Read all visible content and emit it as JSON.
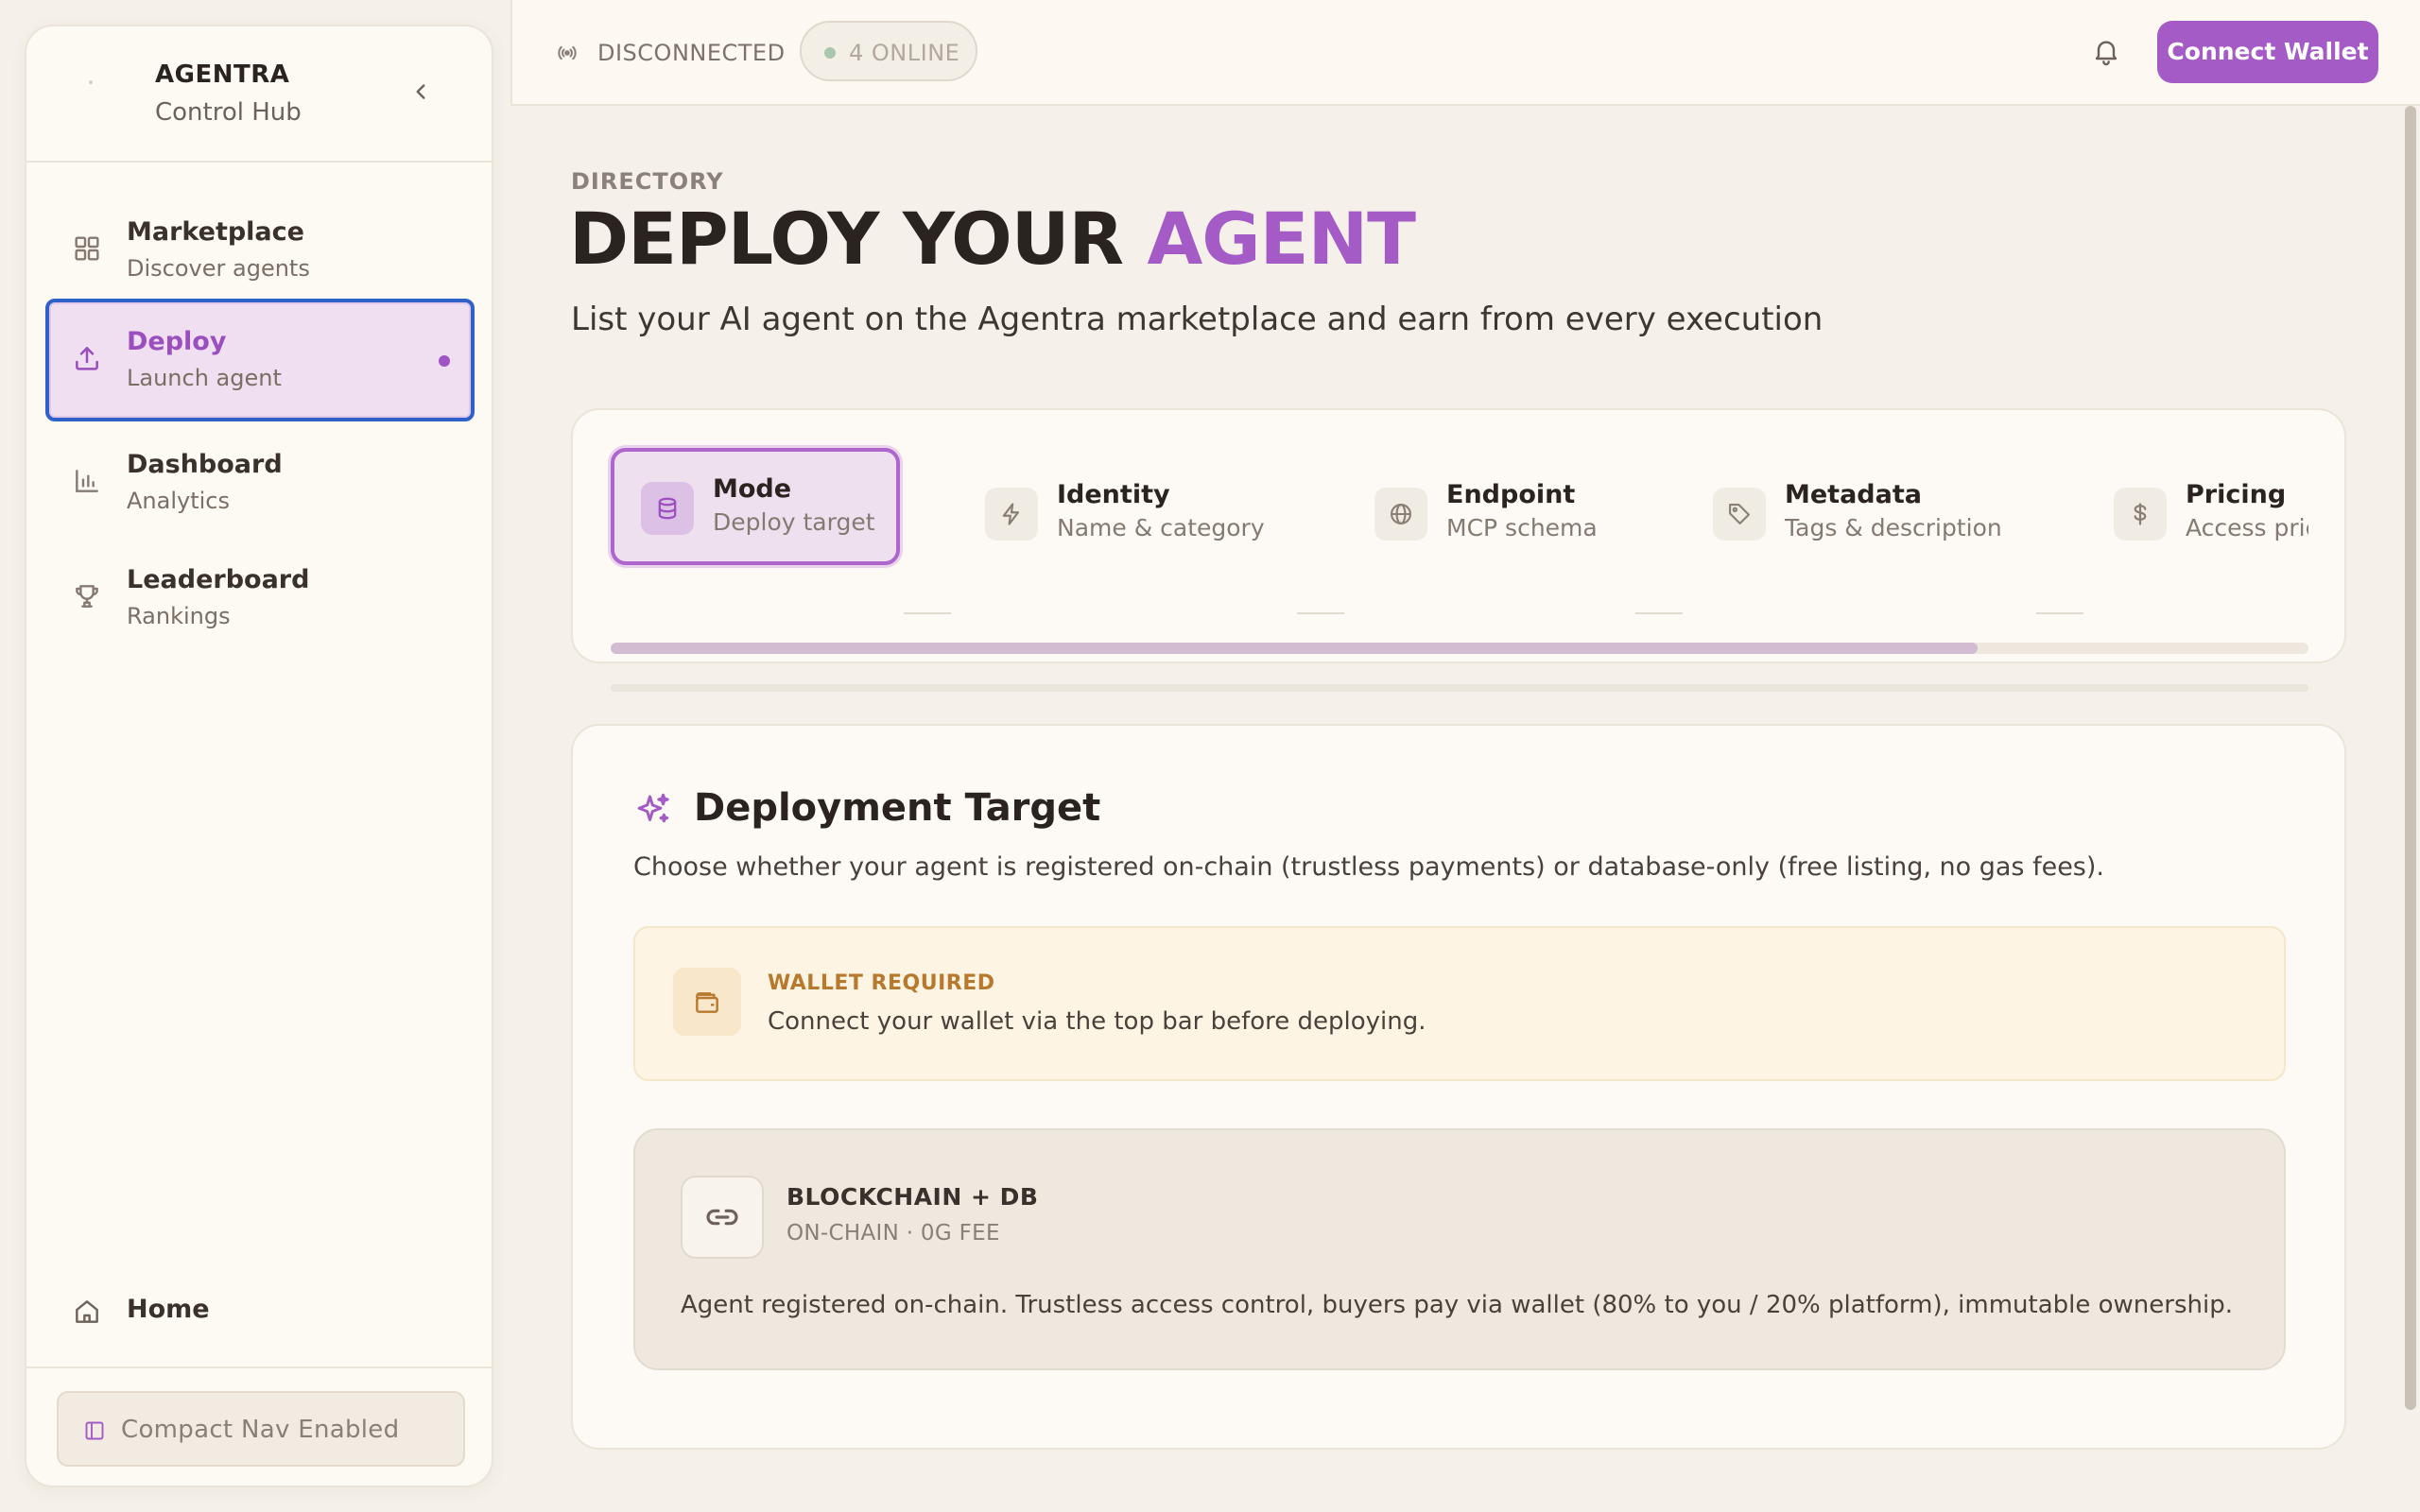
{
  "sidebar": {
    "brand_title": "AGENTRA",
    "brand_subtitle": "Control Hub",
    "items": [
      {
        "label": "Marketplace",
        "sub": "Discover agents",
        "icon": "grid-icon"
      },
      {
        "label": "Deploy",
        "sub": "Launch agent",
        "icon": "upload-icon",
        "active": true
      },
      {
        "label": "Dashboard",
        "sub": "Analytics",
        "icon": "bar-chart-icon"
      },
      {
        "label": "Leaderboard",
        "sub": "Rankings",
        "icon": "trophy-icon"
      }
    ],
    "home_label": "Home",
    "compact_label": "Compact Nav Enabled"
  },
  "topbar": {
    "status": "DISCONNECTED",
    "online": "4 ONLINE",
    "connect_label": "Connect Wallet"
  },
  "main": {
    "eyebrow": "DIRECTORY",
    "title_main": "DEPLOY YOUR",
    "title_accent": "AGENT",
    "lead": "List your AI agent on the Agentra marketplace and earn from every execution"
  },
  "stepper": {
    "steps": [
      {
        "label": "Mode",
        "sub": "Deploy target",
        "icon": "database-icon",
        "active": true
      },
      {
        "label": "Identity",
        "sub": "Name & category",
        "icon": "bolt-icon"
      },
      {
        "label": "Endpoint",
        "sub": "MCP schema",
        "icon": "globe-icon"
      },
      {
        "label": "Metadata",
        "sub": "Tags & description",
        "icon": "tag-icon"
      },
      {
        "label": "Pricing",
        "sub": "Access pric",
        "icon": "dollar-icon"
      }
    ],
    "scroll_progress": 0.805
  },
  "deploy": {
    "title": "Deployment Target",
    "description": "Choose whether your agent is registered on-chain (trustless payments) or database-only (free listing, no gas fees).",
    "warning_title": "WALLET REQUIRED",
    "warning_text": "Connect your wallet via the top bar before deploying.",
    "option_title": "BLOCKCHAIN + DB",
    "option_sub": "ON-CHAIN · 0G FEE",
    "option_desc": "Agent registered on-chain. Trustless access control, buyers pay via wallet (80% to you / 20% platform), immutable ownership."
  },
  "colors": {
    "accent": "#a45bc6",
    "background": "#f5f1ea",
    "warning": "#b7792e"
  }
}
